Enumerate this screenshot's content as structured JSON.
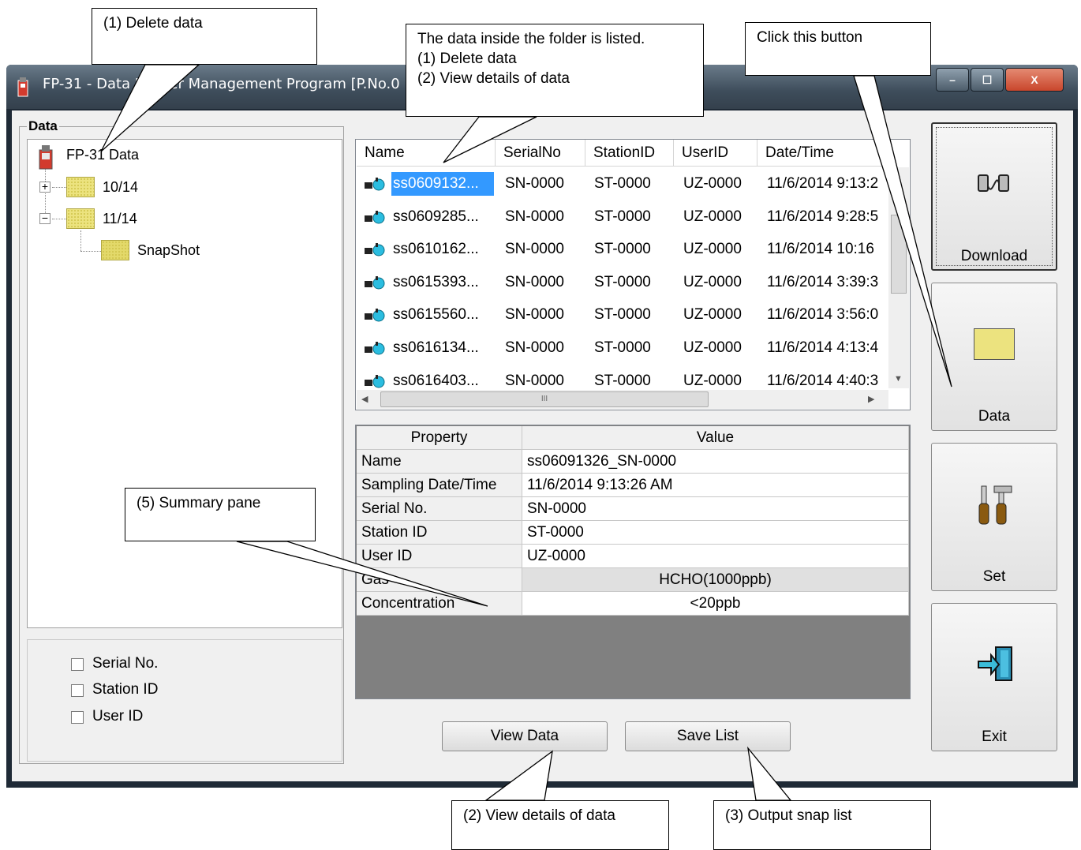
{
  "window": {
    "title": "FP-31  - Data Logger Management Program [P.No.0",
    "minimize": "–",
    "maximize": "☐",
    "close": "X"
  },
  "data_group": {
    "label": "Data"
  },
  "tree": {
    "root": "FP-31 Data",
    "folders": [
      {
        "label": "10/14",
        "expander": "+"
      },
      {
        "label": "11/14",
        "expander": "−"
      }
    ],
    "child": "SnapShot"
  },
  "filters": [
    {
      "label": "Serial No.",
      "checked": false
    },
    {
      "label": "Station ID",
      "checked": false
    },
    {
      "label": "User ID",
      "checked": false
    }
  ],
  "list": {
    "columns": [
      "Name",
      "SerialNo",
      "StationID",
      "UserID",
      "Date/Time"
    ],
    "rows": [
      [
        "ss0609132...",
        "SN-0000",
        "ST-0000",
        "UZ-0000",
        "11/6/2014 9:13:2"
      ],
      [
        "ss0609285...",
        "SN-0000",
        "ST-0000",
        "UZ-0000",
        "11/6/2014 9:28:5"
      ],
      [
        "ss0610162...",
        "SN-0000",
        "ST-0000",
        "UZ-0000",
        "11/6/2014 10:16"
      ],
      [
        "ss0615393...",
        "SN-0000",
        "ST-0000",
        "UZ-0000",
        "11/6/2014 3:39:3"
      ],
      [
        "ss0615560...",
        "SN-0000",
        "ST-0000",
        "UZ-0000",
        "11/6/2014 3:56:0"
      ],
      [
        "ss0616134...",
        "SN-0000",
        "ST-0000",
        "UZ-0000",
        "11/6/2014 4:13:4"
      ],
      [
        "ss0616403...",
        "SN-0000",
        "ST-0000",
        "UZ-0000",
        "11/6/2014 4:40:3"
      ]
    ],
    "selected_index": 0,
    "hscroll_thumb_text": "III"
  },
  "properties": {
    "headers": [
      "Property",
      "Value"
    ],
    "rows": [
      [
        "Name",
        "ss06091326_SN-0000"
      ],
      [
        "Sampling Date/Time",
        "11/6/2014 9:13:26 AM"
      ],
      [
        "Serial No.",
        "SN-0000"
      ],
      [
        "Station ID",
        "ST-0000"
      ],
      [
        "User ID",
        "UZ-0000"
      ],
      [
        "Gas",
        "HCHO(1000ppb)"
      ],
      [
        "Concentration",
        "<20ppb"
      ]
    ]
  },
  "buttons": {
    "view_data": "View Data",
    "save_list": "Save List",
    "download": "Download",
    "data": "Data",
    "set": "Set",
    "exit": "Exit"
  },
  "callouts": {
    "delete_data": "(1) Delete data",
    "list_note": [
      "The data inside the folder is listed.",
      "(1) Delete data",
      "(2) View details of data"
    ],
    "click_button": "Click this button",
    "summary_pane": "(5) Summary pane",
    "view_details": "(2) View details of data",
    "output_snap": "(3) Output snap list"
  },
  "colors": {
    "selection": "#3399ff",
    "folder": "#ece37f",
    "titlebar": "#3e4d5b",
    "close_button": "#c9462c"
  }
}
